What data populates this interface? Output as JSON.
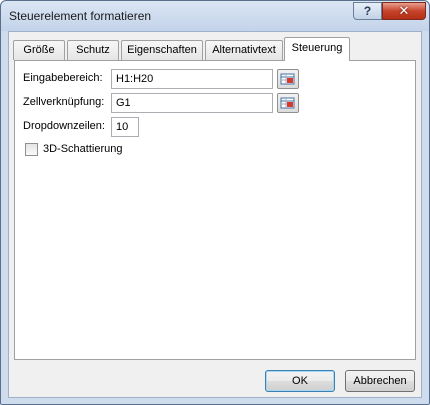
{
  "window": {
    "title": "Steuerelement formatieren",
    "help_label": "?",
    "close_label": "✕"
  },
  "tabs": [
    {
      "label": "Größe",
      "active": false
    },
    {
      "label": "Schutz",
      "active": false
    },
    {
      "label": "Eigenschaften",
      "active": false
    },
    {
      "label": "Alternativtext",
      "active": false
    },
    {
      "label": "Steuerung",
      "active": true
    }
  ],
  "form": {
    "input_range_label": "Eingabebereich:",
    "input_range_value": "H1:H20",
    "cell_link_label": "Zellverknüpfung:",
    "cell_link_value": "G1",
    "dropdown_lines_label": "Dropdownzeilen:",
    "dropdown_lines_value": "10",
    "shading_label": "3D-Schattierung",
    "shading_checked": false
  },
  "buttons": {
    "ok": "OK",
    "cancel": "Abbrechen"
  },
  "icons": {
    "ref_picker": "range-selector-icon"
  }
}
